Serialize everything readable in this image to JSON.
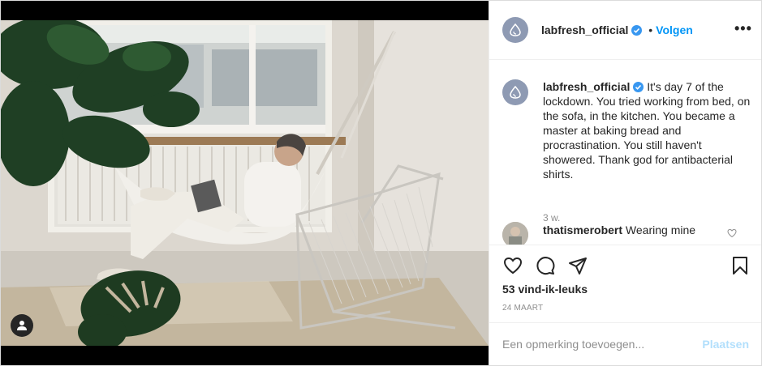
{
  "post": {
    "username": "labfresh_official",
    "follow_label": "Volgen",
    "separator": "•",
    "more_label": "•••"
  },
  "caption": {
    "username": "labfresh_official",
    "text": "It's day 7 of the lockdown. You tried working from bed, on the sofa, in the kitchen. You became a master at baking bread and procrastination. You still haven't showered. Thank god for antibacterial shirts.",
    "time": "3 w."
  },
  "comment": {
    "username": "thatismerobert",
    "text": "Wearing mine"
  },
  "actions": {
    "likes": "53 vind-ik-leuks",
    "date": "24 MAART"
  },
  "add_comment": {
    "placeholder": "Een opmerking toevoegen...",
    "post_label": "Plaatsen"
  },
  "icons": [
    "user-tag-icon",
    "verified-badge-icon",
    "more-options-icon",
    "like-heart-icon",
    "comment-icon",
    "share-icon",
    "save-bookmark-icon",
    "comment-like-heart-icon",
    "brand-drop-icon"
  ],
  "colors": {
    "accent": "#0095f6",
    "post_disabled": "#b2dffc",
    "avatar": "#8e9ab3",
    "text": "#262626",
    "muted": "#8e8e8e"
  }
}
